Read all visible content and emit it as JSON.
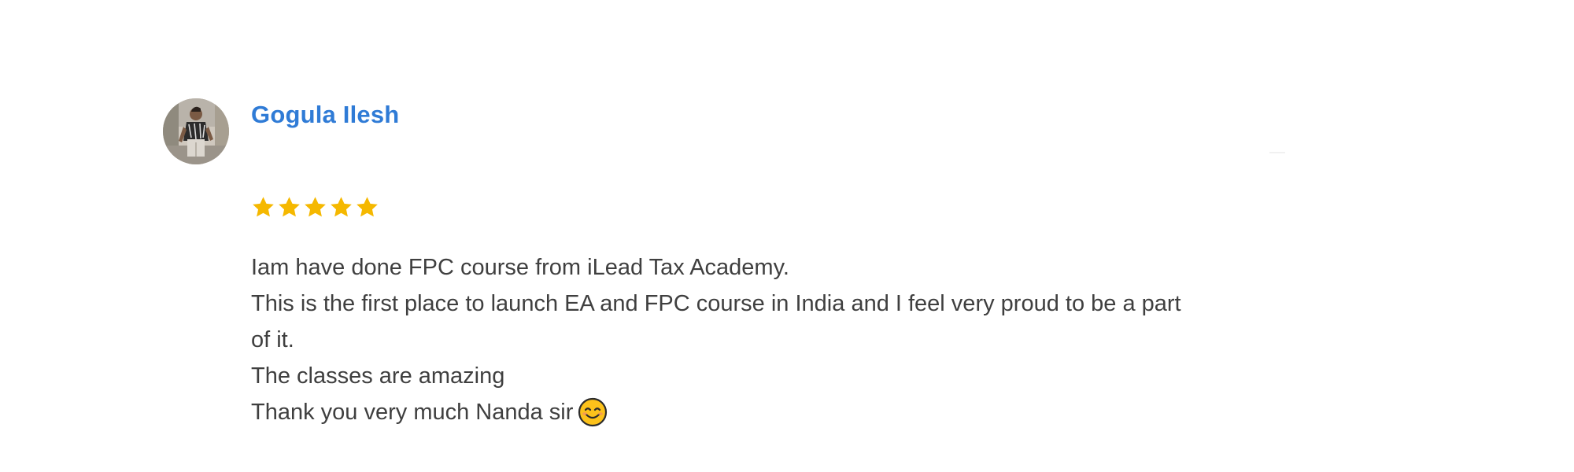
{
  "review": {
    "reviewer_name": "Gogula Ilesh",
    "rating": 5,
    "rating_max": 5,
    "star_color": "#f5b800",
    "name_color": "#2f7bd6",
    "text_lines": [
      "Iam have done FPC course from iLead Tax Academy.",
      "This is the first place to launch EA and FPC course in India and I feel very proud to be a part",
      "of it.",
      "The classes are amazing",
      "Thank you very much Nanda sir"
    ],
    "emoji": "smiling-face-with-smiling-eyes"
  }
}
